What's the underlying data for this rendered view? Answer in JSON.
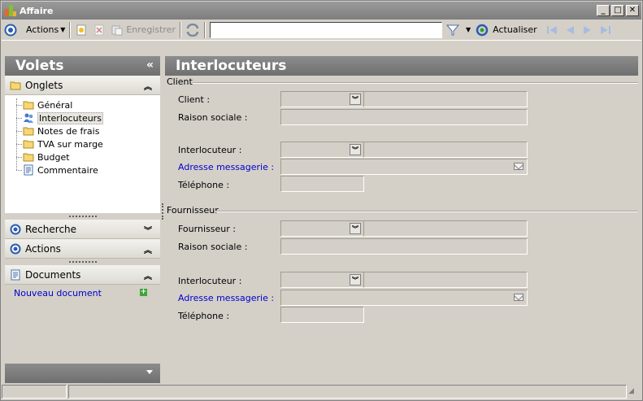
{
  "window": {
    "title": "Affaire"
  },
  "toolbar": {
    "actions_label": "Actions",
    "save_label": "Enregistrer",
    "search_value": "",
    "refresh_label": "Actualiser"
  },
  "left": {
    "volets_title": "Volets",
    "onglets_title": "Onglets",
    "tree_items": [
      "Général",
      "Interlocuteurs",
      "Notes de frais",
      "TVA sur marge",
      "Budget",
      "Commentaire"
    ],
    "recherche_title": "Recherche",
    "actions_title": "Actions",
    "documents_title": "Documents",
    "new_document_label": "Nouveau document"
  },
  "main": {
    "title": "Interlocuteurs",
    "client": {
      "group_label": "Client",
      "client_label": "Client :",
      "raison_label": "Raison sociale :",
      "interlocuteur_label": "Interlocuteur :",
      "email_label": "Adresse messagerie :",
      "phone_label": "Téléphone :"
    },
    "fournisseur": {
      "group_label": "Fournisseur",
      "fournisseur_label": "Fournisseur :",
      "raison_label": "Raison sociale :",
      "interlocuteur_label": "Interlocuteur :",
      "email_label": "Adresse messagerie :",
      "phone_label": "Téléphone :"
    }
  },
  "colors": {
    "header_gray": "#7e7e7e",
    "link_blue": "#0000cc",
    "panel_bg": "#d4d0c8"
  }
}
